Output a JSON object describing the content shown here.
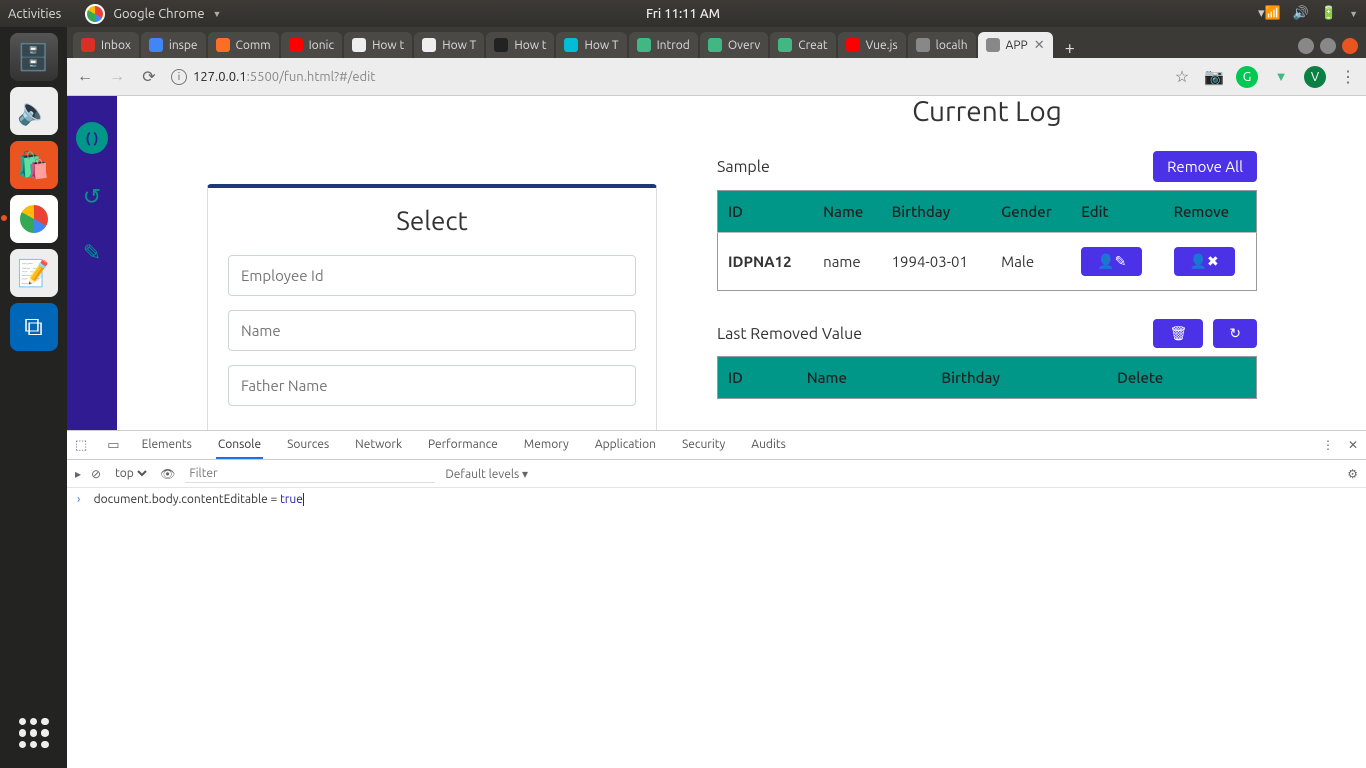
{
  "ubuntu": {
    "activities": "Activities",
    "app_menu": "Google Chrome",
    "clock": "Fri 11:11 AM"
  },
  "tabs": [
    {
      "label": "Inbox",
      "fav": "#d93025"
    },
    {
      "label": "inspe",
      "fav": "#4285f4"
    },
    {
      "label": "Comm",
      "fav": "#fc6d26"
    },
    {
      "label": "Ionic",
      "fav": "#ff0000"
    },
    {
      "label": "How t",
      "fav": "#eee"
    },
    {
      "label": "How T",
      "fav": "#eee"
    },
    {
      "label": "How t",
      "fav": "#222"
    },
    {
      "label": "How T",
      "fav": "#00bcd4"
    },
    {
      "label": "Introd",
      "fav": "#41b883"
    },
    {
      "label": "Overv",
      "fav": "#41b883"
    },
    {
      "label": "Creat",
      "fav": "#41b883"
    },
    {
      "label": "Vue.js",
      "fav": "#ff0000"
    },
    {
      "label": "localh",
      "fav": "#888"
    },
    {
      "label": "APP",
      "fav": "#888",
      "active": true
    }
  ],
  "url": {
    "host": "127.0.0.1",
    "port_path": ":5500/fun.html?#/edit"
  },
  "form": {
    "title": "Select",
    "emp_id_ph": "Employee Id",
    "name_ph": "Name",
    "father_ph": "Father Name"
  },
  "log": {
    "heading": "Current Log",
    "sample_label": "Sample",
    "remove_all": "Remove All",
    "columns": {
      "id": "ID",
      "name": "Name",
      "birthday": "Birthday",
      "gender": "Gender",
      "edit": "Edit",
      "remove": "Remove"
    },
    "rows": [
      {
        "id": "IDPNA12",
        "name": "name",
        "birthday": "1994-03-01",
        "gender": "Male"
      }
    ],
    "removed_label": "Last Removed Value",
    "removed_columns": {
      "id": "ID",
      "name": "Name",
      "birthday": "Birthday",
      "delete": "Delete"
    }
  },
  "devtools": {
    "tabs": [
      "Elements",
      "Console",
      "Sources",
      "Network",
      "Performance",
      "Memory",
      "Application",
      "Security",
      "Audits"
    ],
    "active_tab": "Console",
    "context": "top",
    "filter_ph": "Filter",
    "levels": "Default levels",
    "console_line": {
      "prefix": "document.body.contentEditable = ",
      "value": "true"
    }
  }
}
